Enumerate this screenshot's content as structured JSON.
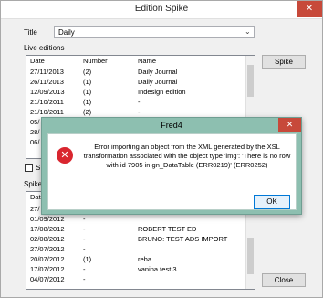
{
  "window": {
    "title": "Edition Spike",
    "close_glyph": "✕"
  },
  "title_field": {
    "label": "Title",
    "value": "Daily"
  },
  "live_editions": {
    "label": "Live editions",
    "headers": [
      "Date",
      "Number",
      "Name"
    ],
    "rows": [
      [
        "27/11/2013",
        "(2)",
        "Daily Journal"
      ],
      [
        "26/11/2013",
        "(1)",
        "Daily Journal"
      ],
      [
        "12/09/2013",
        "(1)",
        "Indesign edition"
      ],
      [
        "21/10/2011",
        "(1)",
        "-"
      ],
      [
        "21/10/2011",
        "(2)",
        "-"
      ],
      [
        "05/",
        "",
        ""
      ],
      [
        "28/",
        "",
        ""
      ],
      [
        "06/",
        "",
        ""
      ]
    ]
  },
  "spike_button": "Spike",
  "checkbox_label": "SI",
  "spiked_editions": {
    "label": "Spike",
    "headers": [
      "Dat"
    ],
    "rows": [
      [
        "27/",
        "",
        ""
      ],
      [
        "01/09/2012",
        "-",
        ""
      ],
      [
        "17/08/2012",
        "-",
        "ROBERT TEST ED"
      ],
      [
        "02/08/2012",
        "-",
        "BRUNO: TEST ADS IMPORT"
      ],
      [
        "27/07/2012",
        "-",
        ""
      ],
      [
        "20/07/2012",
        "(1)",
        "reba"
      ],
      [
        "17/07/2012",
        "-",
        "vanina test 3"
      ],
      [
        "04/07/2012",
        "-",
        ""
      ]
    ]
  },
  "close_button": "Close",
  "dialog": {
    "title": "Fred4",
    "close_glyph": "✕",
    "icon": "error-icon",
    "icon_glyph": "✕",
    "message_lines": [
      "Error importing an object from the XML generated by the XSL",
      "transformation associated with the object type 'img': 'There is no row",
      "with id 7905 in gn_DataTable (ERR0219)' (ERR0252)"
    ],
    "ok_button": "OK"
  },
  "colors": {
    "dialog_frame": "#8dbfb0",
    "close_red": "#c7493a",
    "error_red": "#d9262f",
    "focus_blue": "#0078d7"
  }
}
